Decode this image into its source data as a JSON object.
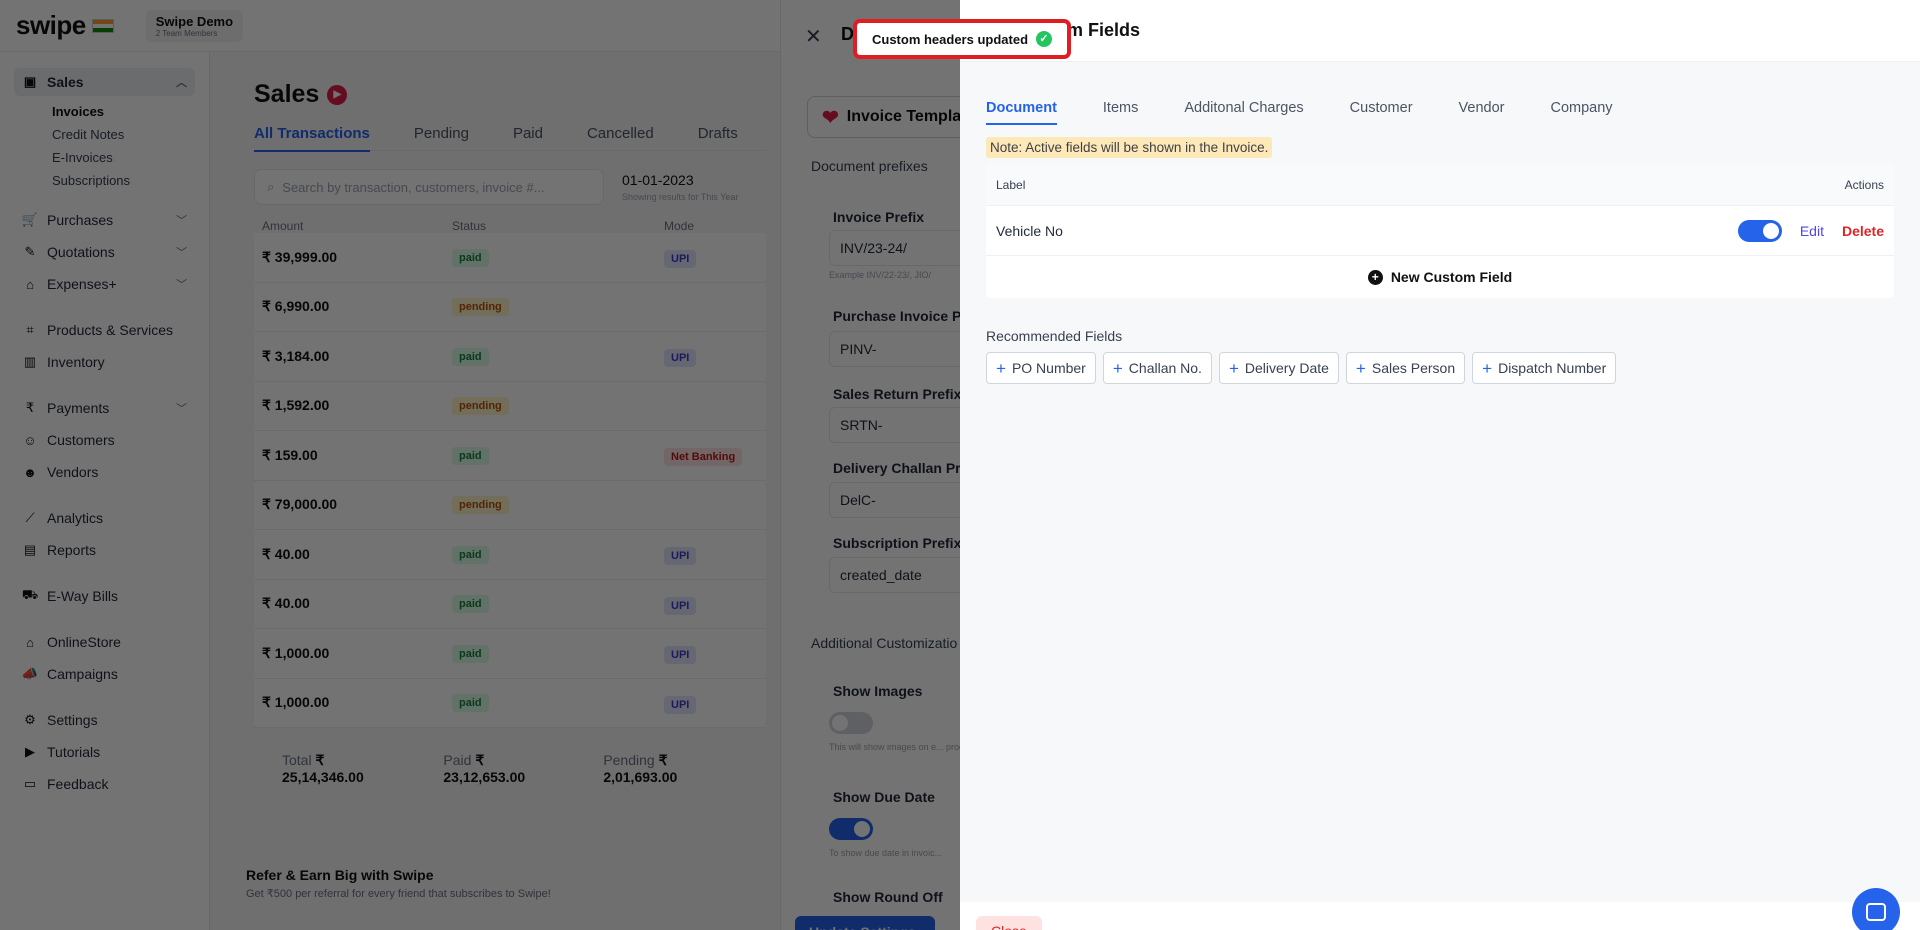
{
  "topbar": {
    "logo": "swipe",
    "company_name": "Swipe Demo",
    "company_sub": "2 Team Members"
  },
  "sidebar": {
    "sales": "Sales",
    "sales_items": [
      "Invoices",
      "Credit Notes",
      "E-Invoices",
      "Subscriptions"
    ],
    "purchases": "Purchases",
    "quotations": "Quotations",
    "expenses": "Expenses+",
    "products": "Products & Services",
    "inventory": "Inventory",
    "payments": "Payments",
    "customers": "Customers",
    "vendors": "Vendors",
    "analytics": "Analytics",
    "reports": "Reports",
    "eway": "E-Way Bills",
    "onlinestore": "OnlineStore",
    "campaigns": "Campaigns",
    "settings": "Settings",
    "tutorials": "Tutorials",
    "feedback": "Feedback"
  },
  "main": {
    "title": "Sales",
    "tabs": [
      "All Transactions",
      "Pending",
      "Paid",
      "Cancelled",
      "Drafts"
    ],
    "search_placeholder": "Search by transaction, customers, invoice #...",
    "date": "01-01-2023",
    "date_note": "Showing results for This Year",
    "columns": [
      "Amount",
      "Status",
      "Mode"
    ],
    "rows": [
      {
        "amount": "₹ 39,999.00",
        "status": "paid",
        "mode": "UPI"
      },
      {
        "amount": "₹ 6,990.00",
        "status": "pending",
        "mode": ""
      },
      {
        "amount": "₹ 3,184.00",
        "status": "paid",
        "mode": "UPI"
      },
      {
        "amount": "₹ 1,592.00",
        "status": "pending",
        "mode": ""
      },
      {
        "amount": "₹ 159.00",
        "status": "paid",
        "mode": "Net Banking"
      },
      {
        "amount": "₹ 79,000.00",
        "status": "pending",
        "mode": ""
      },
      {
        "amount": "₹ 40.00",
        "status": "paid",
        "mode": "UPI"
      },
      {
        "amount": "₹ 40.00",
        "status": "paid",
        "mode": "UPI"
      },
      {
        "amount": "₹ 1,000.00",
        "status": "paid",
        "mode": "UPI"
      },
      {
        "amount": "₹ 1,000.00",
        "status": "paid",
        "mode": "UPI"
      }
    ],
    "total_label": "Total",
    "total_value": "₹ 25,14,346.00",
    "paid_label": "Paid",
    "paid_value": "₹ 23,12,653.00",
    "pending_label": "Pending",
    "pending_value": "₹ 2,01,693.00",
    "refer_title": "Refer & Earn Big with Swipe",
    "refer_sub": "Get ₹500 per referral for every friend that subscribes to Swipe!"
  },
  "settings_panel": {
    "title_prefix": "D",
    "template_btn": "Invoice Templa",
    "doc_prefixes": "Document prefixes",
    "invoice_prefix_label": "Invoice Prefix",
    "invoice_prefix_value": "INV/23-24/",
    "invoice_prefix_hint": "Example INV/22-23/, JIO/",
    "purchase_prefix_label": "Purchase Invoice Pr",
    "purchase_prefix_value": "PINV-",
    "sales_return_label": "Sales Return Prefix",
    "sales_return_value": "SRTN-",
    "delivery_label": "Delivery Challan Pre",
    "delivery_value": "DelC-",
    "subscription_label": "Subscription Prefix",
    "subscription_value": "created_date",
    "additional": "Additional Customizatio",
    "show_images": "Show Images",
    "show_images_hint": "This will show images on e... product. Upto 5 images on...",
    "show_due_date": "Show Due Date",
    "show_due_hint": "To show due date in invoic...",
    "show_round_off": "Show Round Off",
    "update_btn": "Update Settings"
  },
  "drawer": {
    "title": "Custom Fields",
    "tabs": [
      "Document",
      "Items",
      "Additonal Charges",
      "Customer",
      "Vendor",
      "Company"
    ],
    "note": "Note: Active fields will be shown in the Invoice.",
    "col_label": "Label",
    "col_actions": "Actions",
    "fields": [
      {
        "label": "Vehicle No",
        "active": true
      }
    ],
    "edit": "Edit",
    "delete": "Delete",
    "new_field": "New Custom Field",
    "recommended_title": "Recommended Fields",
    "recommended": [
      "PO Number",
      "Challan No.",
      "Delivery Date",
      "Sales Person",
      "Dispatch Number"
    ],
    "close": "Close"
  },
  "toast": {
    "message": "Custom headers updated"
  },
  "colors": {
    "accent": "#2563eb",
    "danger": "#dc2626",
    "highlight_ring": "#e11d24",
    "success": "#22c55e"
  }
}
